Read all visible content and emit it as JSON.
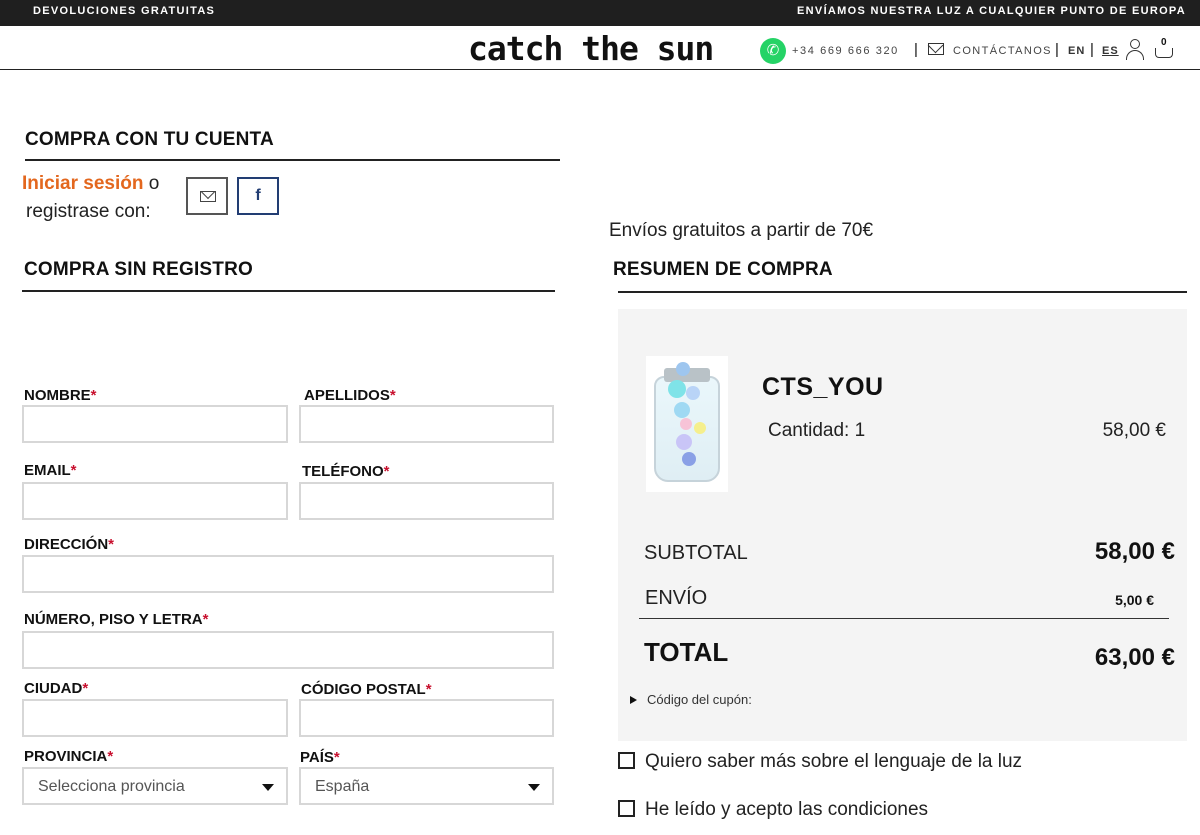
{
  "topbar": {
    "left_text": "DEVOLUCIONES GRATUITAS",
    "right_text": "ENVÍAMOS NUESTRA LUZ A CUALQUIER PUNTO DE EUROPA"
  },
  "header": {
    "logo": "catch the sun",
    "phone": "+34 669 666 320",
    "contact_label": "CONTÁCTANOS",
    "lang_en": "EN",
    "lang_es": "ES",
    "separator": "|",
    "cart_count": "0"
  },
  "account": {
    "title": "COMPRA CON TU CUENTA",
    "login_link": "Iniciar sesión",
    "login_suffix": " o",
    "login_line2": "registrase con:",
    "facebook_label": "f"
  },
  "guest": {
    "title": "COMPRA SIN REGISTRO",
    "required_mark": "*",
    "fields": {
      "nombre": "NOMBRE",
      "apellidos": "APELLIDOS",
      "email": "EMAIL",
      "telefono": "TELÉFONO",
      "direccion": "DIRECCIÓN",
      "numero": "NÚMERO, PISO Y LETRA",
      "ciudad": "CIUDAD",
      "codigo_postal": "CÓDIGO POSTAL",
      "provincia": "PROVINCIA",
      "pais": "PAÍS"
    },
    "provincia_value": "Selecciona provincia",
    "pais_value": "España"
  },
  "summary": {
    "shipping_info": "Envíos gratuitos a partir de 70€",
    "title": "RESUMEN DE COMPRA",
    "product_name": "CTS_YOU",
    "quantity": "Cantidad: 1",
    "product_price": "58,00 €",
    "subtotal_label": "SUBTOTAL",
    "subtotal_value": "58,00 €",
    "envio_label": "ENVÍO",
    "envio_value": "5,00 €",
    "total_label": "TOTAL",
    "total_value": "63,00 €",
    "coupon_label": "Código del cupón:"
  },
  "checkboxes": {
    "newsletter": "Quiero saber más sobre el lenguaje de la luz",
    "terms": "He leído y acepto las condiciones"
  },
  "colors": {
    "accent_orange": "#e3671e",
    "required_red": "#c8102e",
    "facebook_blue": "#223d73",
    "whatsapp_green": "#25d366",
    "topbar_bg": "#1f1f1f"
  }
}
